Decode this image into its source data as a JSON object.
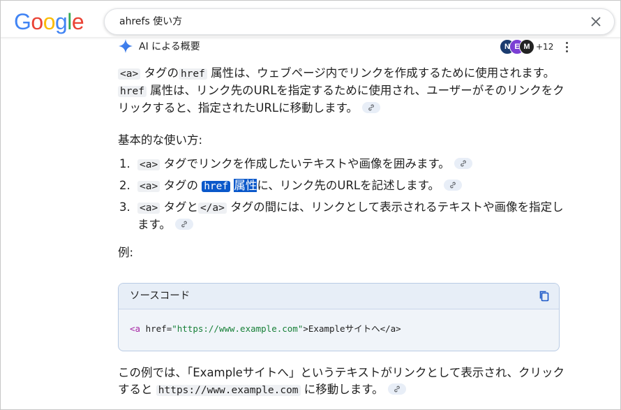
{
  "header": {
    "logo_letters": [
      "G",
      "o",
      "o",
      "g",
      "l",
      "e"
    ],
    "search_value": "ahrefs 使い方"
  },
  "ai": {
    "title": "AI による概要",
    "avatar_letters": [
      "N",
      "E",
      "M"
    ],
    "more_count": "+12"
  },
  "answer": {
    "intro": [
      {
        "t": "code",
        "v": "<a>"
      },
      {
        "t": "text",
        "v": " タグの"
      },
      {
        "t": "code",
        "v": "href"
      },
      {
        "t": "text",
        "v": " 属性は、ウェブページ内でリンクを作成するために使用されます。"
      },
      {
        "t": "code",
        "v": "href"
      },
      {
        "t": "text",
        "v": " 属性は、リンク先のURLを指定するために使用され、ユーザーがそのリンクをクリックすると、指定されたURLに移動します。"
      }
    ],
    "basic_heading": "基本的な使い方:",
    "steps": [
      {
        "num": "1.",
        "parts": [
          {
            "t": "code",
            "v": "<a>"
          },
          {
            "t": "text",
            "v": " タグでリンクを作成したいテキストや画像を囲みます。"
          }
        ]
      },
      {
        "num": "2.",
        "parts": [
          {
            "t": "code",
            "v": "<a>"
          },
          {
            "t": "text",
            "v": " タグの "
          },
          {
            "t": "selcode",
            "v": "href"
          },
          {
            "t": "text",
            "v": " "
          },
          {
            "t": "seltext",
            "v": "属性"
          },
          {
            "t": "text",
            "v": "に、リンク先のURLを記述します。"
          }
        ]
      },
      {
        "num": "3.",
        "parts": [
          {
            "t": "code",
            "v": "<a>"
          },
          {
            "t": "text",
            "v": " タグと"
          },
          {
            "t": "code",
            "v": "</a>"
          },
          {
            "t": "text",
            "v": " タグの間には、リンクとして表示されるテキストや画像を指定します。"
          }
        ]
      }
    ],
    "example_heading": "例:",
    "code_block": {
      "title": "ソースコード",
      "tag_open": "<a",
      "attr": " href=",
      "value": "\"https://www.example.com\"",
      "rest": ">Exampleサイトへ</a>"
    },
    "outro": [
      {
        "t": "text",
        "v": "この例では、「Exampleサイトへ」というテキストがリンクとして表示され、クリックすると "
      },
      {
        "t": "code",
        "v": "https://www.example.com"
      },
      {
        "t": "text",
        "v": " に移動します。"
      }
    ]
  },
  "colors": {
    "google_blue": "#4285F4",
    "google_red": "#EA4335",
    "google_yellow": "#FBBC05",
    "google_green": "#34A853",
    "selection": "#0a58ca"
  }
}
